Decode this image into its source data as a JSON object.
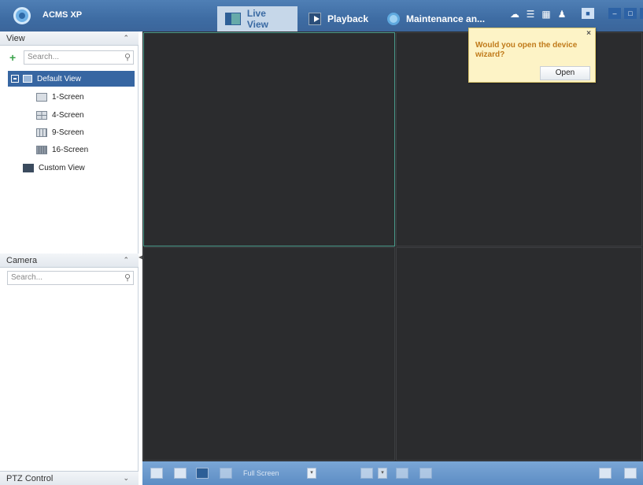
{
  "app": {
    "title": "ACMS XP"
  },
  "tabs": [
    {
      "label": "Live View",
      "icon": "live-view-icon"
    },
    {
      "label": "Playback",
      "icon": "playback-icon"
    },
    {
      "label": "Maintenance an...",
      "icon": "maintenance-icon"
    }
  ],
  "view_panel": {
    "heading": "View",
    "search_placeholder": "Search...",
    "tree": [
      {
        "label": "Default View",
        "selected": true
      },
      {
        "label": "1-Screen"
      },
      {
        "label": "4-Screen"
      },
      {
        "label": "9-Screen"
      },
      {
        "label": "16-Screen"
      },
      {
        "label": "Custom View"
      }
    ]
  },
  "camera_panel": {
    "heading": "Camera",
    "search_placeholder": "Search..."
  },
  "ptz_panel": {
    "heading": "PTZ Control"
  },
  "popup": {
    "message": "Would you open the device wizard?",
    "button": "Open"
  },
  "toolbar": {
    "full_screen_label": "Full Screen"
  },
  "colors": {
    "titlebar": "#4272ab",
    "accent": "#3766a2",
    "video_bg": "#2d2e30",
    "popup_text": "#c07a1a"
  }
}
